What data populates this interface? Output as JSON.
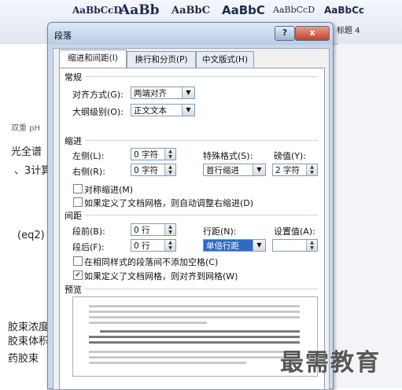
{
  "background": {
    "style_samples": [
      "AaBbCcD",
      "AaBb",
      "AaBbC",
      "AaBbC",
      "AaBbCcD",
      "AaBbCc"
    ],
    "heading_label": "标题 4",
    "doc_lines": [
      "双重 pH",
      "光全谱",
      "、3计算",
      "(eq2)",
      "胶束浓度",
      "胶束体积",
      "药胶束"
    ]
  },
  "dialog": {
    "title": "段落",
    "help_label": "?",
    "close_label": "x",
    "tabs": [
      "缩进和间距(I)",
      "换行和分页(P)",
      "中文版式(H)"
    ],
    "general": {
      "section": "常规",
      "alignment_label": "对齐方式(G):",
      "alignment_value": "两端对齐",
      "outline_label": "大纲级别(O):",
      "outline_value": "正文文本"
    },
    "indent": {
      "section": "缩进",
      "left_label": "左侧(L):",
      "left_value": "0 字符",
      "right_label": "右侧(R):",
      "right_value": "0 字符",
      "special_label": "特殊格式(S):",
      "special_value": "首行缩进",
      "by_label": "磅值(Y):",
      "by_value": "2 字符",
      "mirror_label": "对称缩进(M)",
      "auto_adjust_label": "如果定义了文档网格，则自动调整右缩进(D)"
    },
    "spacing": {
      "section": "间距",
      "before_label": "段前(B):",
      "before_value": "0 行",
      "after_label": "段后(F):",
      "after_value": "0 行",
      "line_label": "行距(N):",
      "line_value": "单倍行距",
      "at_label": "设置值(A):",
      "at_value": "",
      "no_space_label": "在相同样式的段落间不添加空格(C)",
      "snap_grid_label": "如果定义了文档网格，则对齐到网格(W)",
      "snap_grid_checked": true
    },
    "preview": {
      "section": "预览"
    }
  },
  "watermark": "最需教育"
}
